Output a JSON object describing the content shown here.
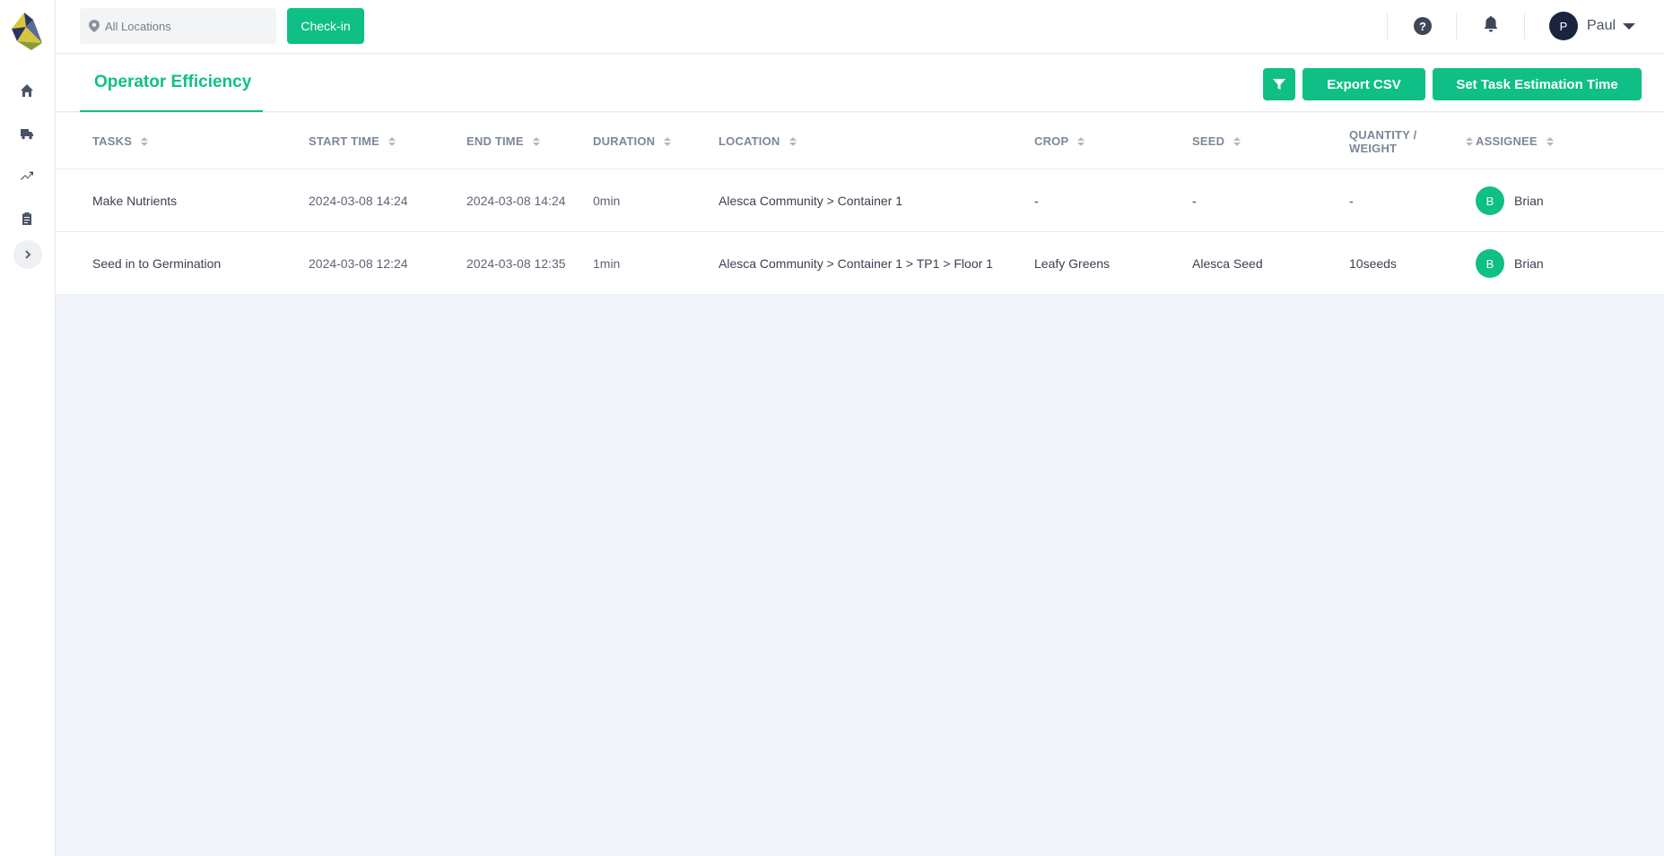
{
  "topbar": {
    "location_placeholder": "All Locations",
    "checkin_label": "Check-in",
    "help_label": "?",
    "user": {
      "initial": "P",
      "name": "Paul"
    }
  },
  "sidebar": {
    "icons": [
      "home-icon",
      "truck-icon",
      "trending-up-icon",
      "clipboard-icon"
    ]
  },
  "page": {
    "tab_label": "Operator Efficiency",
    "export_label": "Export CSV",
    "estimate_label": "Set Task Estimation Time"
  },
  "table": {
    "headers": {
      "tasks": "TASKS",
      "start_time": "START TIME",
      "end_time": "END TIME",
      "duration": "DURATION",
      "location": "LOCATION",
      "crop": "CROP",
      "seed": "SEED",
      "quantity_line1": "QUANTITY /",
      "quantity_line2": "WEIGHT",
      "assignee": "ASSIGNEE"
    },
    "rows": [
      {
        "task": "Make Nutrients",
        "start": "2024-03-08 14:24",
        "end": "2024-03-08 14:24",
        "duration": "0min",
        "location": "Alesca Community > Container 1",
        "crop": "-",
        "seed": "-",
        "quantity": "-",
        "assignee_initial": "B",
        "assignee": "Brian"
      },
      {
        "task": "Seed in to Germination",
        "start": "2024-03-08 12:24",
        "end": "2024-03-08 12:35",
        "duration": "1min",
        "location": "Alesca Community > Container 1 > TP1 > Floor 1",
        "crop": "Leafy Greens",
        "seed": "Alesca Seed",
        "quantity": "10seeds",
        "assignee_initial": "B",
        "assignee": "Brian"
      }
    ]
  },
  "colors": {
    "accent": "#0fbf86",
    "background": "#f1f4f8",
    "navy": "#1a2440"
  }
}
